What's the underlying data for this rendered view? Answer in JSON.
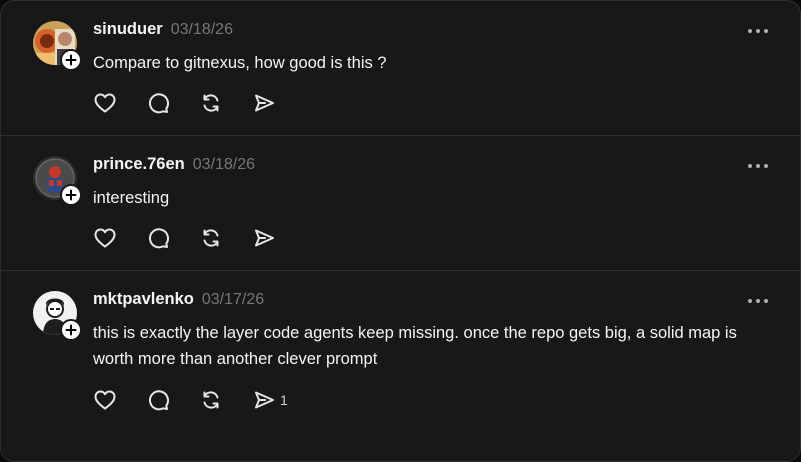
{
  "posts": [
    {
      "username": "sinuduer",
      "date": "03/18/26",
      "text": "Compare to gitnexus, how good is this ?",
      "avatar_icon": "user-avatar-photo",
      "share_count": ""
    },
    {
      "username": "prince.76en",
      "date": "03/18/26",
      "text": "interesting",
      "avatar_icon": "user-avatar-photo",
      "share_count": ""
    },
    {
      "username": "mktpavlenko",
      "date": "03/17/26",
      "text": "this is exactly the layer code agents keep missing. once the repo gets big, a solid map is worth more than another clever prompt",
      "avatar_icon": "user-avatar-photo",
      "share_count": "1"
    }
  ],
  "icons": {
    "like": "heart-icon",
    "reply": "comment-bubble-icon",
    "repost": "repost-icon",
    "share": "send-icon",
    "more": "more-dots-icon",
    "follow": "plus-icon"
  },
  "colors": {
    "background": "#181818",
    "text": "#f3f5f7",
    "muted": "#777777",
    "divider": "#2e2e2e"
  }
}
